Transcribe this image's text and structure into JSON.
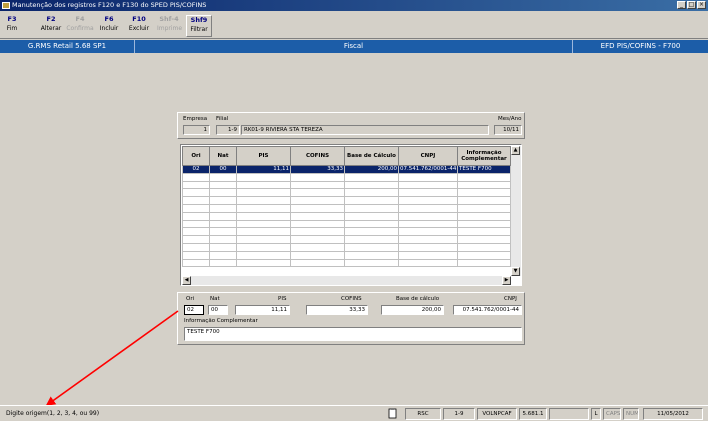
{
  "window": {
    "title": "Manutenção dos registros F120 e F130 do SPED PIS/COFINS"
  },
  "toolbar": {
    "buttons": [
      {
        "key": "F3",
        "label": "Fim"
      },
      {
        "key": "F2",
        "label": "Alterar"
      },
      {
        "key": "F4",
        "label": "Confirma"
      },
      {
        "key": "F6",
        "label": "Incluir"
      },
      {
        "key": "F10",
        "label": "Excluir"
      },
      {
        "key": "Shf-4",
        "label": "Imprime"
      },
      {
        "key": "Shf9",
        "label": "Filtrar"
      }
    ]
  },
  "header": {
    "product": "G.RMS Retail 5.68 SP1",
    "module": "Fiscal",
    "screen": "EFD PIS/COFINS - F700"
  },
  "filter": {
    "empresa_label": "Empresa",
    "empresa": "1",
    "filial_label": "Filial",
    "filial_num": "1-9",
    "filial_name": "RK01-9 RIVIERA STA TEREZA",
    "mesano_label": "Mes/Ano",
    "mesano": "10/11"
  },
  "grid": {
    "columns": [
      "Ori",
      "Nat",
      "PIS",
      "COFINS",
      "Base de Cálculo",
      "CNPJ",
      "Informação Complementar"
    ],
    "rows": [
      {
        "ori": "02",
        "nat": "00",
        "pis": "11,11",
        "cofins": "33,33",
        "base": "200,00",
        "cnpj": "07.541.762/0001-44",
        "info": "TESTE F700"
      }
    ]
  },
  "detail": {
    "ori_label": "Ori",
    "ori": "02",
    "nat_label": "Nat",
    "nat": "00",
    "pis_label": "PIS",
    "pis": "11,11",
    "cofins_label": "COFINS",
    "cofins": "33,33",
    "base_label": "Base de cálculo",
    "base": "200,00",
    "cnpj_label": "CNPJ",
    "cnpj": "07.541.762/0001-44",
    "info_label": "Informação Complementar",
    "info": "TESTE F700"
  },
  "status": {
    "hint": "Digite origem(1, 2, 3, 4, ou 99)",
    "cells": [
      "RSC",
      "1-9",
      "VOLNPCAF",
      "5.681.1",
      "",
      "L",
      "CAPS",
      "NUM",
      "11/05/2012"
    ]
  },
  "colors": {
    "bluebar": "#1c5da8",
    "selection": "#0a246a",
    "arrow": "#ff0000"
  }
}
